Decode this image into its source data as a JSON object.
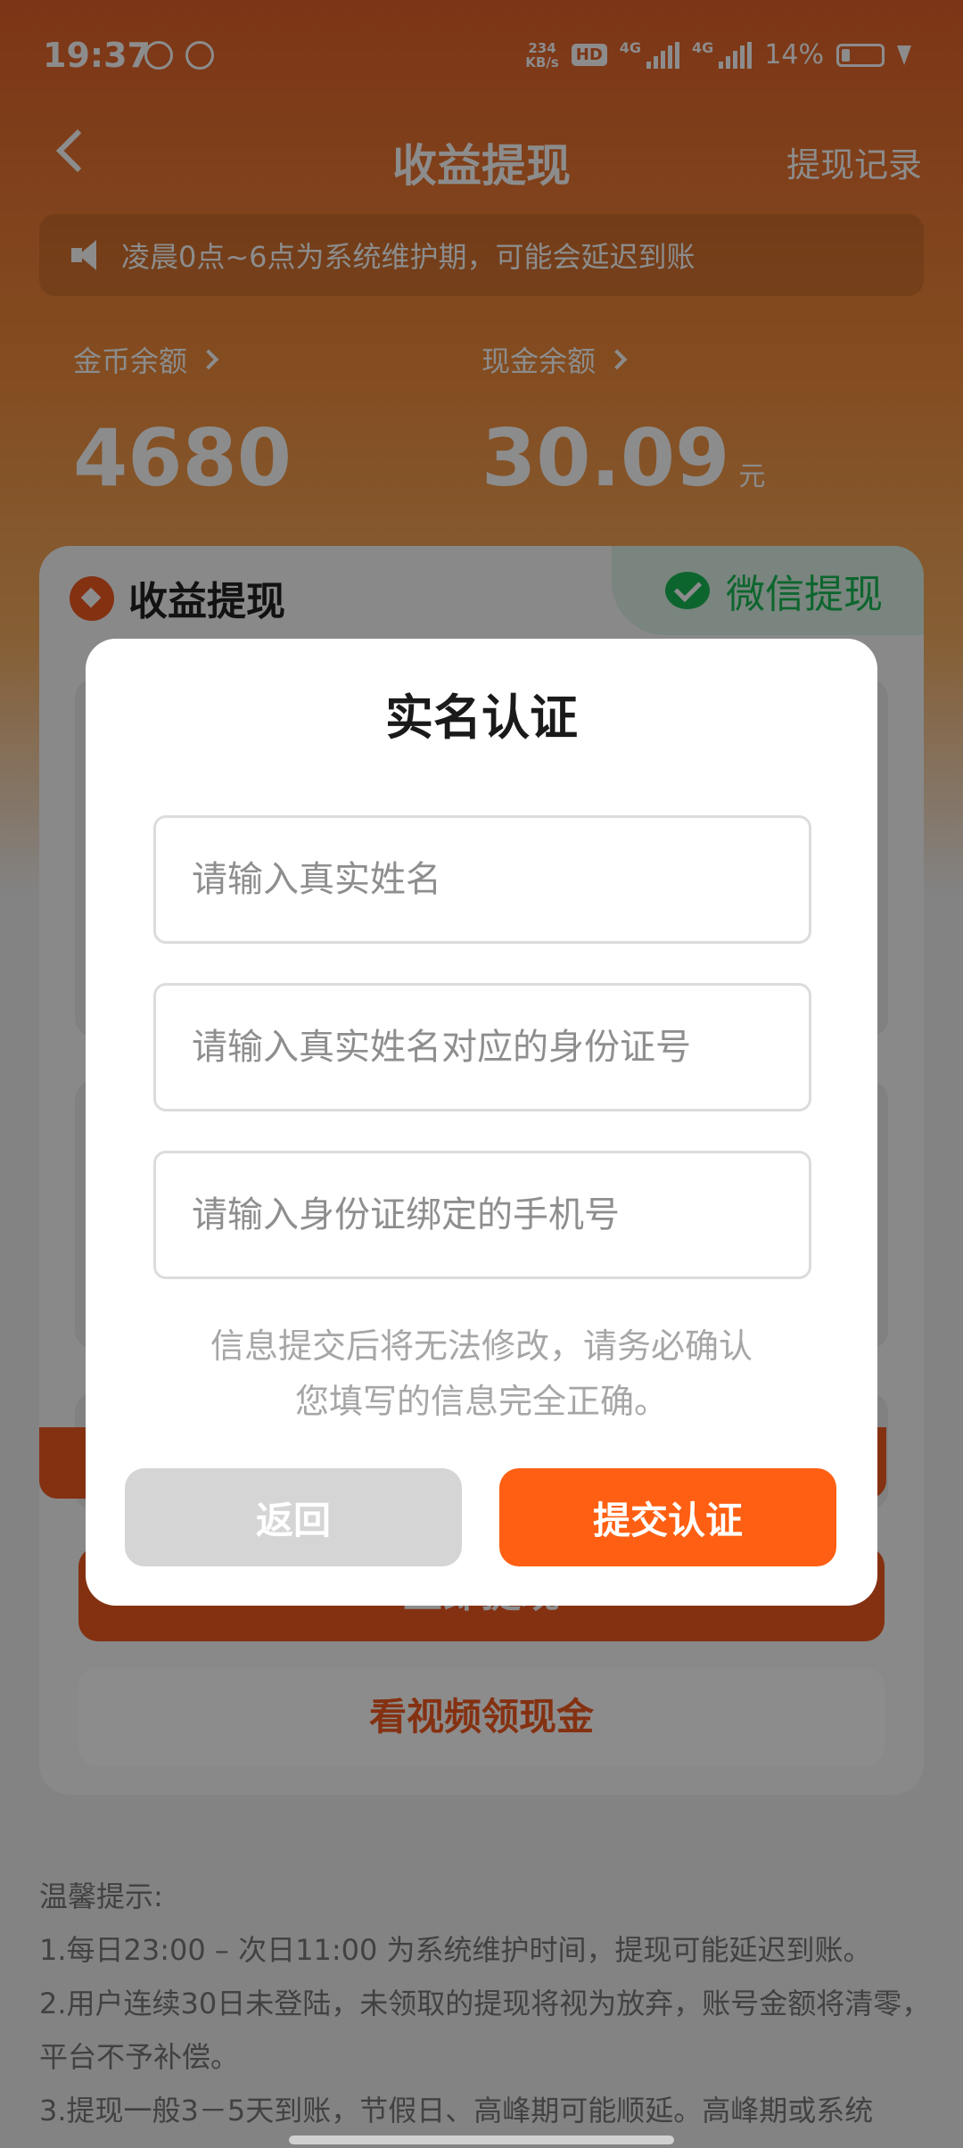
{
  "status_bar": {
    "time": "19:37",
    "net_speed_top": "234",
    "net_speed_unit": "KB/s",
    "hd_badge": "HD",
    "network_1": "4G",
    "network_2": "4G",
    "battery": "14%"
  },
  "header": {
    "title": "收益提现",
    "record_link": "提现记录"
  },
  "notice": {
    "text": "凌晨0点~6点为系统维护期，可能会延迟到账"
  },
  "balances": {
    "coin_label": "金币余额",
    "coin_value": "4680",
    "cash_label": "现金余额",
    "cash_value": "30.09",
    "cash_unit": "元"
  },
  "card": {
    "title": "收益提现",
    "wechat_tab": "微信提现",
    "withdraw_button": "立即提现",
    "video_button": "看视频领现金"
  },
  "tips": {
    "heading": "温馨提示:",
    "line1": "1.每日23:00 – 次日11:00 为系统维护时间，提现可能延迟到账。",
    "line2": "2.用户连续30日未登陆，未领取的提现将视为放弃，账号金额将清零，平台不予补偿。",
    "line3": "3.提现一般3－5天到账，节假日、高峰期可能顺延。高峰期或系统"
  },
  "dialog": {
    "title": "实名认证",
    "name_placeholder": "请输入真实姓名",
    "id_placeholder": "请输入真实姓名对应的身份证号",
    "phone_placeholder": "请输入身份证绑定的手机号",
    "note_line1": "信息提交后将无法修改，请务必确认",
    "note_line2": "您填写的信息完全正确。",
    "back_button": "返回",
    "submit_button": "提交认证"
  },
  "colors": {
    "accent": "#ff5f12",
    "wechat_green": "#19b955"
  }
}
